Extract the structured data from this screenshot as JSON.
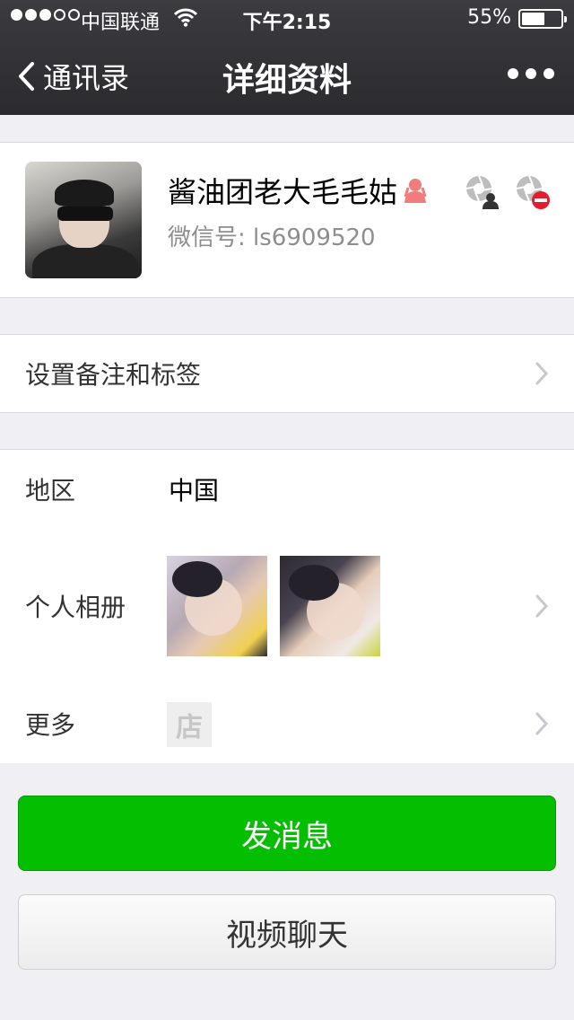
{
  "status_bar": {
    "carrier": "中国联通",
    "time": "下午2:15",
    "battery_percent": "55%",
    "battery_level": 0.55,
    "signal_bars_filled": 3,
    "signal_bars_total": 5
  },
  "nav": {
    "back_label": "通讯录",
    "title": "详细资料"
  },
  "profile": {
    "name": "酱油团老大毛毛姑",
    "wechat_id_label": "微信号:",
    "wechat_id": "ls6909520",
    "gender_icon": "female-icon"
  },
  "remark_row": {
    "label": "设置备注和标签"
  },
  "info": {
    "region_label": "地区",
    "region_value": "中国",
    "album_label": "个人相册",
    "more_label": "更多",
    "shop_glyph": "店"
  },
  "buttons": {
    "send_message": "发消息",
    "video_chat": "视频聊天"
  },
  "colors": {
    "accent_green": "#04be02",
    "nav_bg": "#2b2b2e",
    "page_bg": "#efeff4"
  }
}
